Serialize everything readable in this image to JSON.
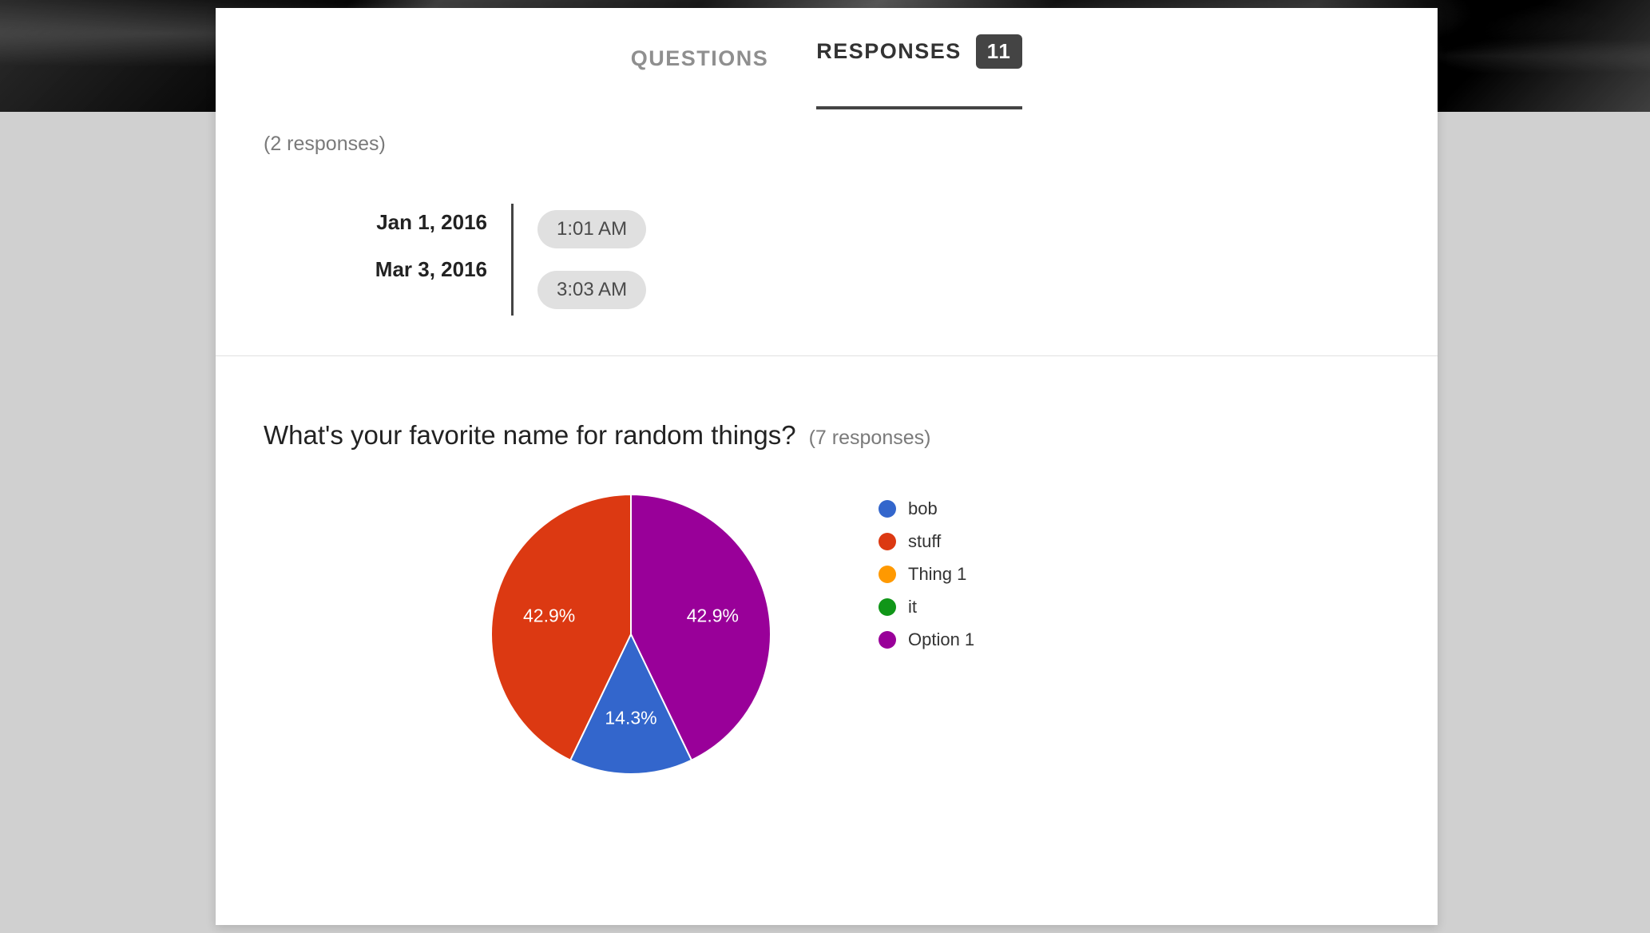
{
  "tabs": {
    "questions": "QUESTIONS",
    "responses": "RESPONSES",
    "responses_count": "11"
  },
  "section1": {
    "count_label": "(2 responses)",
    "rows": [
      {
        "date": "Jan 1, 2016",
        "time": "1:01 AM"
      },
      {
        "date": "Mar 3, 2016",
        "time": "3:03 AM"
      }
    ]
  },
  "section2": {
    "title": "What's your favorite name for random things?",
    "count_label": "(7 responses)"
  },
  "chart_data": {
    "type": "pie",
    "title": "What's your favorite name for random things?",
    "series": [
      {
        "name": "bob",
        "value": 14.3,
        "color": "#3366cc",
        "label": "14.3%"
      },
      {
        "name": "stuff",
        "value": 42.9,
        "color": "#dc3912",
        "label": "42.9%"
      },
      {
        "name": "Thing 1",
        "value": 0,
        "color": "#ff9900",
        "label": ""
      },
      {
        "name": "it",
        "value": 0,
        "color": "#109618",
        "label": ""
      },
      {
        "name": "Option 1",
        "value": 42.9,
        "color": "#990099",
        "label": "42.9%"
      }
    ]
  }
}
